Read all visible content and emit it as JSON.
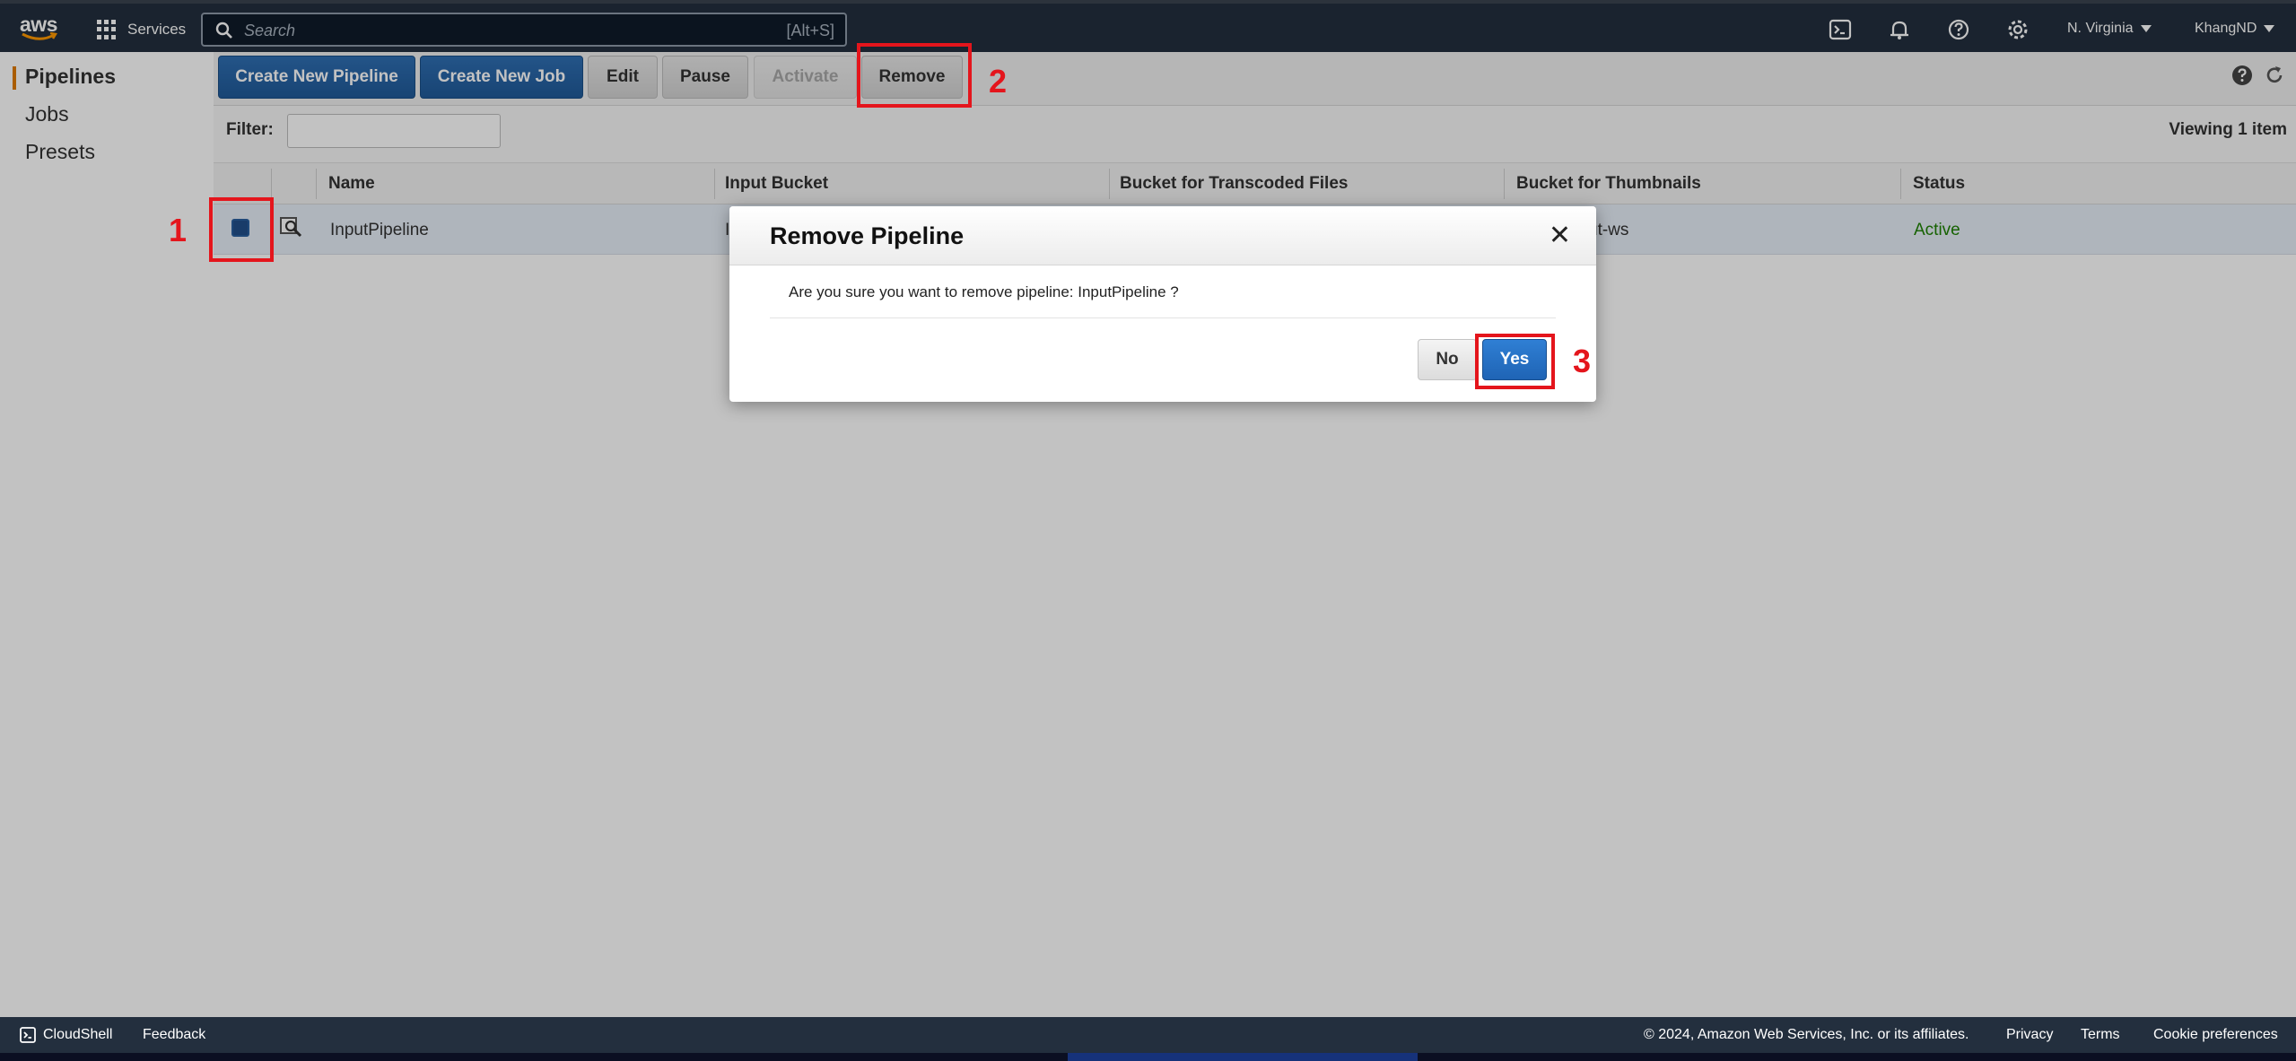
{
  "topnav": {
    "logo": "aws",
    "services_label": "Services",
    "search_placeholder": "Search",
    "search_shortcut": "[Alt+S]",
    "region": "N. Virginia",
    "user": "KhangND",
    "icons": [
      "cloudshell-icon",
      "bell-icon",
      "help-icon",
      "settings-icon"
    ]
  },
  "sidebar": {
    "items": [
      {
        "label": "Pipelines",
        "active": true
      },
      {
        "label": "Jobs",
        "active": false
      },
      {
        "label": "Presets",
        "active": false
      }
    ]
  },
  "toolbar": {
    "create_pipeline": "Create New Pipeline",
    "create_job": "Create New Job",
    "edit": "Edit",
    "pause": "Pause",
    "activate": "Activate",
    "remove": "Remove"
  },
  "filter": {
    "label": "Filter:",
    "value": "",
    "viewing": "Viewing 1 item"
  },
  "table": {
    "columns": [
      "Name",
      "Input Bucket",
      "Bucket for Transcoded Files",
      "Bucket for Thumbnails",
      "Status"
    ],
    "rows": [
      {
        "name": "InputPipeline",
        "input_bucket_visible": "I",
        "thumbnails_visible": "ut-ws",
        "status": "Active"
      }
    ]
  },
  "modal": {
    "title": "Remove Pipeline",
    "close": "✕",
    "message": "Are you sure you want to remove pipeline: InputPipeline ?",
    "no": "No",
    "yes": "Yes"
  },
  "annotations": [
    "1",
    "2",
    "3"
  ],
  "footer": {
    "cloudshell": "CloudShell",
    "feedback": "Feedback",
    "copyright": "© 2024, Amazon Web Services, Inc. or its affiliates.",
    "privacy": "Privacy",
    "terms": "Terms",
    "cookie": "Cookie preferences"
  },
  "colors": {
    "nav_bg": "#232f3e",
    "primary_blue": "#205a99",
    "active_orange": "#e07b00",
    "status_green": "#1d8102",
    "annotation_red": "#e4151c"
  }
}
